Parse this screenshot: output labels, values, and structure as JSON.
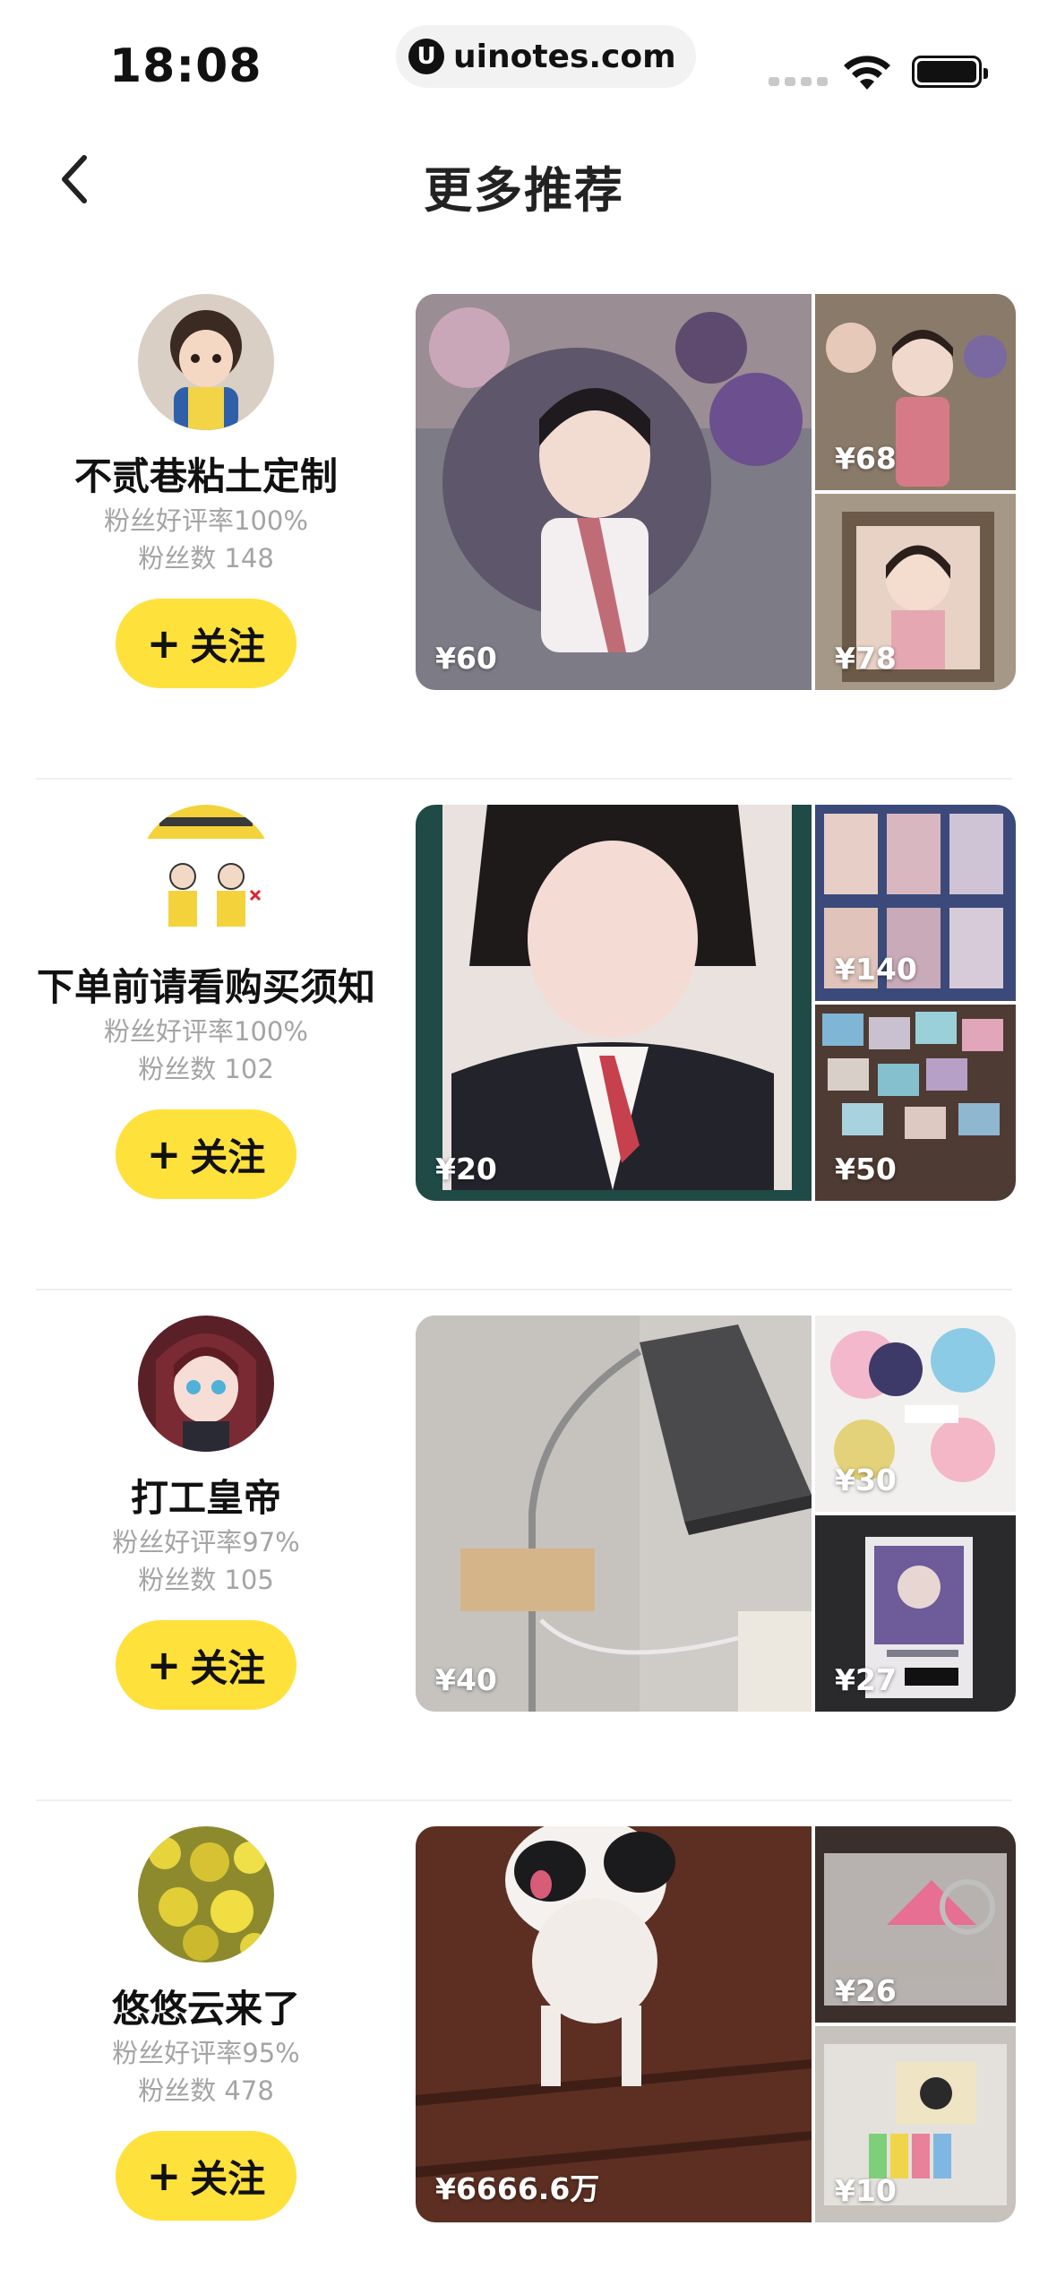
{
  "status_bar": {
    "time": "18:08",
    "url": "uinotes.com",
    "url_logo": "U"
  },
  "nav": {
    "title": "更多推荐",
    "back_icon": "chevron-left-icon"
  },
  "colors": {
    "accent_yellow": "#ffe13c",
    "meta_gray": "#a4a4a4",
    "divider": "#efefef"
  },
  "follow_label": "关注",
  "follow_icon": "plus-icon",
  "sellers": [
    {
      "name": "不贰巷粘土定制",
      "rating": "粉丝好评率100%",
      "fans": "粉丝数 148",
      "avatar_desc": "clay-doll-avatar",
      "photos": [
        {
          "price": "¥60",
          "desc": "clay-figure-photo"
        },
        {
          "price": "¥68",
          "desc": "clay-dolls-photo"
        },
        {
          "price": "¥78",
          "desc": "clay-frame-photo"
        }
      ]
    },
    {
      "name": "下单前请看购买须知",
      "rating": "粉丝好评率100%",
      "fans": "粉丝数 102",
      "avatar_desc": "notice-illustration-avatar",
      "photos": [
        {
          "price": "¥20",
          "desc": "idol-photocard-photo"
        },
        {
          "price": "¥140",
          "desc": "photocard-binder-photo"
        },
        {
          "price": "¥50",
          "desc": "photocard-pile-photo"
        }
      ]
    },
    {
      "name": "打工皇帝",
      "rating": "粉丝好评率97%",
      "fans": "粉丝数 105",
      "avatar_desc": "anime-girl-avatar",
      "photos": [
        {
          "price": "¥40",
          "desc": "desk-lamp-photo"
        },
        {
          "price": "¥30",
          "desc": "anime-stickers-photo"
        },
        {
          "price": "¥27",
          "desc": "anime-card-photo"
        }
      ]
    },
    {
      "name": "悠悠云来了",
      "rating": "粉丝好评率95%",
      "fans": "粉丝数 478",
      "avatar_desc": "yellow-flowers-avatar",
      "photos": [
        {
          "price": "¥6666.6万",
          "desc": "dog-photo"
        },
        {
          "price": "¥26",
          "desc": "pet-cage-photo"
        },
        {
          "price": "¥10",
          "desc": "hamster-house-photo"
        }
      ]
    }
  ]
}
